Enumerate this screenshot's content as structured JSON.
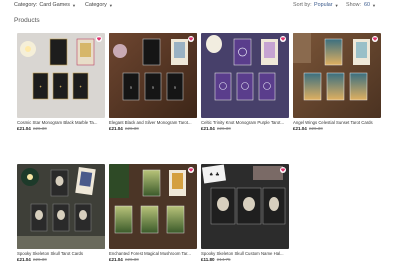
{
  "toolbar": {
    "category_label": "Category:",
    "category_value": "Card Games",
    "subcategory_value": "Category",
    "sort_label": "Sort by:",
    "sort_value": "Popular",
    "show_label": "Show:",
    "show_value": "60"
  },
  "section_title": "Products",
  "products": [
    {
      "title": "Cosmic Star Monogram Black Marble Ta...",
      "price": "£21.04",
      "was": "£26.30"
    },
    {
      "title": "Elegant Black and Silver Monogram Tarot...",
      "price": "£21.04",
      "was": "£26.30"
    },
    {
      "title": "Celtic Trinity Knot Monogram Purple Tarot...",
      "price": "£21.04",
      "was": "£26.30"
    },
    {
      "title": "Angel Wings Celestial Sunset Tarot Cards",
      "price": "£21.04",
      "was": "£26.30"
    },
    {
      "title": "Spooky Skeleton Skull Tarot Cards",
      "price": "£21.04",
      "was": "£26.30"
    },
    {
      "title": "Enchanted Forest Magical Mushroom Tar...",
      "price": "£21.04",
      "was": "£26.30"
    },
    {
      "title": "Spooky Skeleton Skull Custom Name Hal...",
      "price": "£11.80",
      "was": "£14.75"
    }
  ],
  "colors": {
    "heart": "#e0356f",
    "link": "#3a5a8c"
  }
}
